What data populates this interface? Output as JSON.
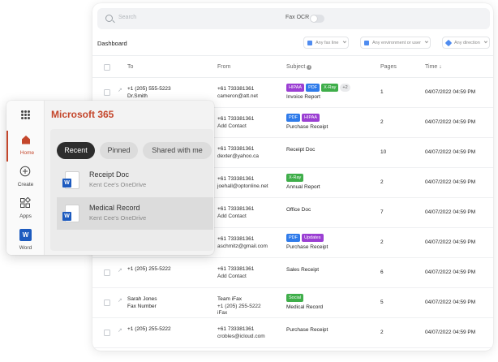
{
  "search": {
    "placeholder": "Search"
  },
  "fax_ocr_label": "Fax OCR",
  "dashboard_title": "Dashboard",
  "filters": [
    {
      "label": "Any fax line"
    },
    {
      "label": "Any environment or user"
    },
    {
      "label": "Any direction"
    }
  ],
  "columns": {
    "to": "To",
    "from": "From",
    "subject": "Subject",
    "pages": "Pages",
    "time": "Time"
  },
  "colors": {
    "hipaa": "#9b3fd3",
    "pdf": "#2f7bea",
    "xray": "#3fae4a",
    "updates": "#9b3fd3",
    "social": "#3fae4a",
    "brand": "#c4462b"
  },
  "rows": [
    {
      "to1": "+1 (205) 555-5223",
      "to2": "Dr.Smith",
      "from1": "+61 733381361",
      "from2": "cameron@att.net",
      "from3": "",
      "tags": [
        "HIPAA",
        "PDF",
        "X-Ray"
      ],
      "more": "+2",
      "subject": "Invoice Report",
      "pages": "1",
      "time": "04/07/2022 04:59 PM"
    },
    {
      "to1": "",
      "to2": "",
      "from1": "+61 733381361",
      "from2": "Add Contact",
      "from3": "",
      "tags": [
        "PDF",
        "HIPAA"
      ],
      "more": "",
      "subject": "Purchase Receipt",
      "pages": "2",
      "time": "04/07/2022 04:59 PM"
    },
    {
      "to1": "",
      "to2": "",
      "from1": "+61 733381361",
      "from2": "dexter@yahoo.ca",
      "from3": "",
      "tags": [],
      "more": "",
      "subject": "Receipt Doc",
      "pages": "10",
      "time": "04/07/2022 04:59 PM"
    },
    {
      "to1": "",
      "to2": "",
      "from1": "+61 733381361",
      "from2": "joehall@optonline.net",
      "from3": "",
      "tags": [
        "X-Ray"
      ],
      "more": "",
      "subject": "Annual Report",
      "pages": "2",
      "time": "04/07/2022 04:59 PM"
    },
    {
      "to1": "",
      "to2": "",
      "from1": "+61 733381361",
      "from2": "Add Contact",
      "from3": "",
      "tags": [],
      "more": "",
      "subject": "Office Doc",
      "pages": "7",
      "time": "04/07/2022 04:59 PM"
    },
    {
      "to1": "",
      "to2": "",
      "from1": "+61 733381361",
      "from2": "aschmitz@gmail.com",
      "from3": "",
      "tags": [
        "PDF",
        "Updates"
      ],
      "more": "",
      "subject": "Purchase Receipt",
      "pages": "2",
      "time": "04/07/2022 04:59 PM"
    },
    {
      "to1": "+1 (205) 255-5222",
      "to2": "",
      "from1": "+61 733381361",
      "from2": "Add Contact",
      "from3": "",
      "tags": [],
      "more": "",
      "subject": "Sales Receipt",
      "pages": "6",
      "time": "04/07/2022 04:59 PM"
    },
    {
      "to1": "Sarah Jones",
      "to2": "Fax Number",
      "from1": "Team iFax",
      "from2": "+1 (205) 255-5222",
      "from3": "iFax",
      "tags": [
        "Social"
      ],
      "more": "",
      "subject": "Medical Record",
      "pages": "5",
      "time": "04/07/2022 04:59 PM"
    },
    {
      "to1": "+1 (205) 255-5222",
      "to2": "",
      "from1": "+61 733381361",
      "from2": "crobles@icloud.com",
      "from3": "",
      "tags": [],
      "more": "",
      "subject": "Purchase Receipt",
      "pages": "2",
      "time": "04/07/2022 04:59 PM"
    }
  ],
  "m365": {
    "brand": "Microsoft 365",
    "rail": [
      {
        "label": "Home",
        "icon": "home-icon"
      },
      {
        "label": "Create",
        "icon": "plus-circle-icon"
      },
      {
        "label": "Apps",
        "icon": "apps-icon"
      },
      {
        "label": "Word",
        "icon": "word-icon"
      }
    ],
    "tabs": [
      "Recent",
      "Pinned",
      "Shared with me"
    ],
    "files": [
      {
        "name": "Receipt Doc",
        "owner": "Kent Cee's OneDrive"
      },
      {
        "name": "Medical Record",
        "owner": "Kent Cee's OneDrive"
      }
    ]
  }
}
